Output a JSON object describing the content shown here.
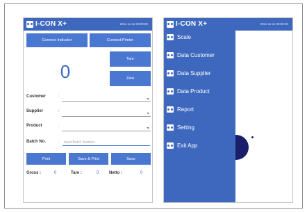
{
  "app": {
    "title": "I-CON X+",
    "datetime": "20xx-xx-xx 00:00:00"
  },
  "buttons": {
    "connect_indicator": "Connect Indicator",
    "connect_printer": "Connect Printer",
    "tare": "Tare",
    "zero": "Zero",
    "print": "Print",
    "save_print": "Save & Print",
    "save": "Save"
  },
  "weight": {
    "value": "0"
  },
  "form": {
    "separator": ":",
    "customer_label": "Customer",
    "supplier_label": "Supplier",
    "product_label": "Product",
    "batch_label": "Batch No.",
    "batch_placeholder": "Input Batch Number"
  },
  "totals": {
    "gross_label": "Gross :",
    "gross_value": "0",
    "tare_label": "Tare :",
    "tare_value": "0",
    "netto_label": "Netto :",
    "netto_value": "0"
  },
  "menu": {
    "items": [
      {
        "label": "Scale",
        "icon": "app-logo-icon"
      },
      {
        "label": "Data Customer",
        "icon": "app-logo-icon"
      },
      {
        "label": "Data Supplier",
        "icon": "app-logo-icon"
      },
      {
        "label": "Data Product",
        "icon": "app-logo-icon"
      },
      {
        "label": "Report",
        "icon": "app-logo-icon"
      },
      {
        "label": "Setting",
        "icon": "app-logo-icon"
      },
      {
        "label": "Exit App",
        "icon": "app-logo-icon"
      }
    ]
  },
  "colors": {
    "primary": "#3e68be",
    "button": "#4a78d0",
    "accent_dark": "#1a1f6b"
  }
}
